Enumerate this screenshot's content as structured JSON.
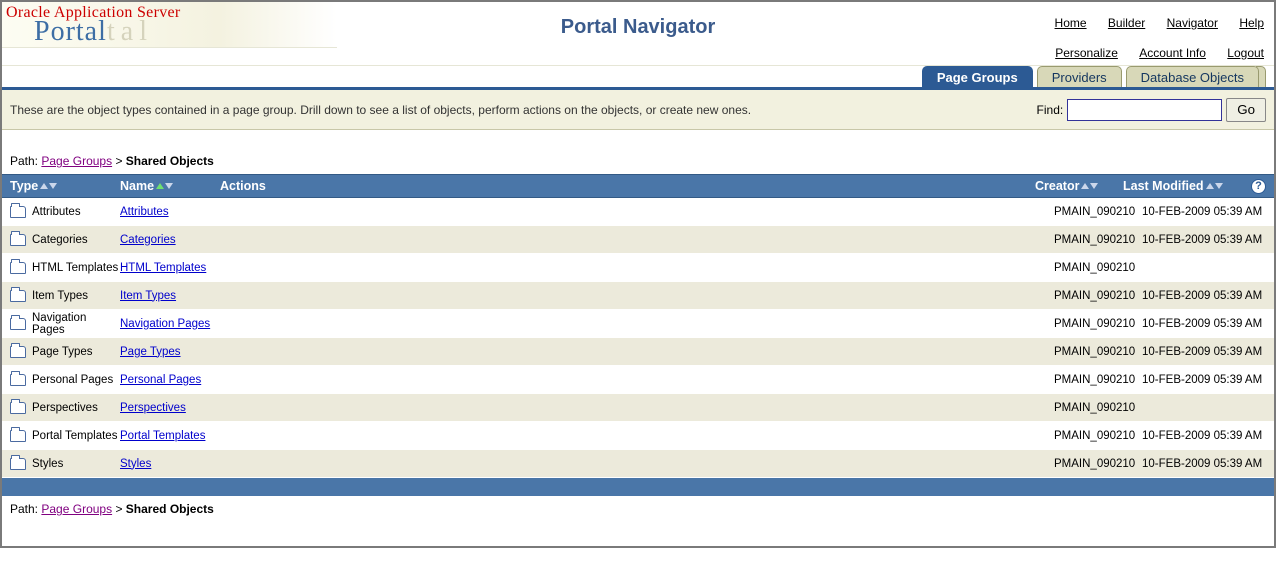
{
  "logo": {
    "line1": "Oracle Application Server",
    "line2": "Portal"
  },
  "title": "Portal Navigator",
  "topnav": {
    "row1": [
      "Home",
      "Builder",
      "Navigator",
      "Help"
    ],
    "row2": [
      "Personalize",
      "Account Info",
      "Logout"
    ]
  },
  "tabs": {
    "active": "Page Groups",
    "others": [
      "Providers",
      "Database Objects"
    ]
  },
  "toolbar": {
    "description": "These are the object types contained in a page group. Drill down to see a list of objects, perform actions on the objects, or create new ones.",
    "find_label": "Find:",
    "find_value": "",
    "go_label": "Go"
  },
  "breadcrumb": {
    "prefix": "Path:",
    "link": "Page Groups",
    "sep": ">",
    "current": "Shared Objects"
  },
  "columns": {
    "type": "Type",
    "name": "Name",
    "actions": "Actions",
    "creator": "Creator",
    "modified": "Last Modified"
  },
  "rows": [
    {
      "type": "Attributes",
      "name": "Attributes",
      "creator": "PMAIN_090210",
      "modified": "10-FEB-2009 05:39 AM",
      "alt": false
    },
    {
      "type": "Categories",
      "name": "Categories",
      "creator": "PMAIN_090210",
      "modified": "10-FEB-2009 05:39 AM",
      "alt": true
    },
    {
      "type": "HTML Templates",
      "name": "HTML Templates",
      "creator": "PMAIN_090210",
      "modified": "",
      "alt": false
    },
    {
      "type": "Item Types",
      "name": "Item Types",
      "creator": "PMAIN_090210",
      "modified": "10-FEB-2009 05:39 AM",
      "alt": true
    },
    {
      "type": "Navigation Pages",
      "name": "Navigation Pages",
      "creator": "PMAIN_090210",
      "modified": "10-FEB-2009 05:39 AM",
      "alt": false
    },
    {
      "type": "Page Types",
      "name": "Page Types",
      "creator": "PMAIN_090210",
      "modified": "10-FEB-2009 05:39 AM",
      "alt": true
    },
    {
      "type": "Personal Pages",
      "name": "Personal Pages",
      "creator": "PMAIN_090210",
      "modified": "10-FEB-2009 05:39 AM",
      "alt": false
    },
    {
      "type": "Perspectives",
      "name": "Perspectives",
      "creator": "PMAIN_090210",
      "modified": "",
      "alt": true
    },
    {
      "type": "Portal Templates",
      "name": "Portal Templates",
      "creator": "PMAIN_090210",
      "modified": "10-FEB-2009 05:39 AM",
      "alt": false
    },
    {
      "type": "Styles",
      "name": "Styles",
      "creator": "PMAIN_090210",
      "modified": "10-FEB-2009 05:39 AM",
      "alt": true
    }
  ]
}
